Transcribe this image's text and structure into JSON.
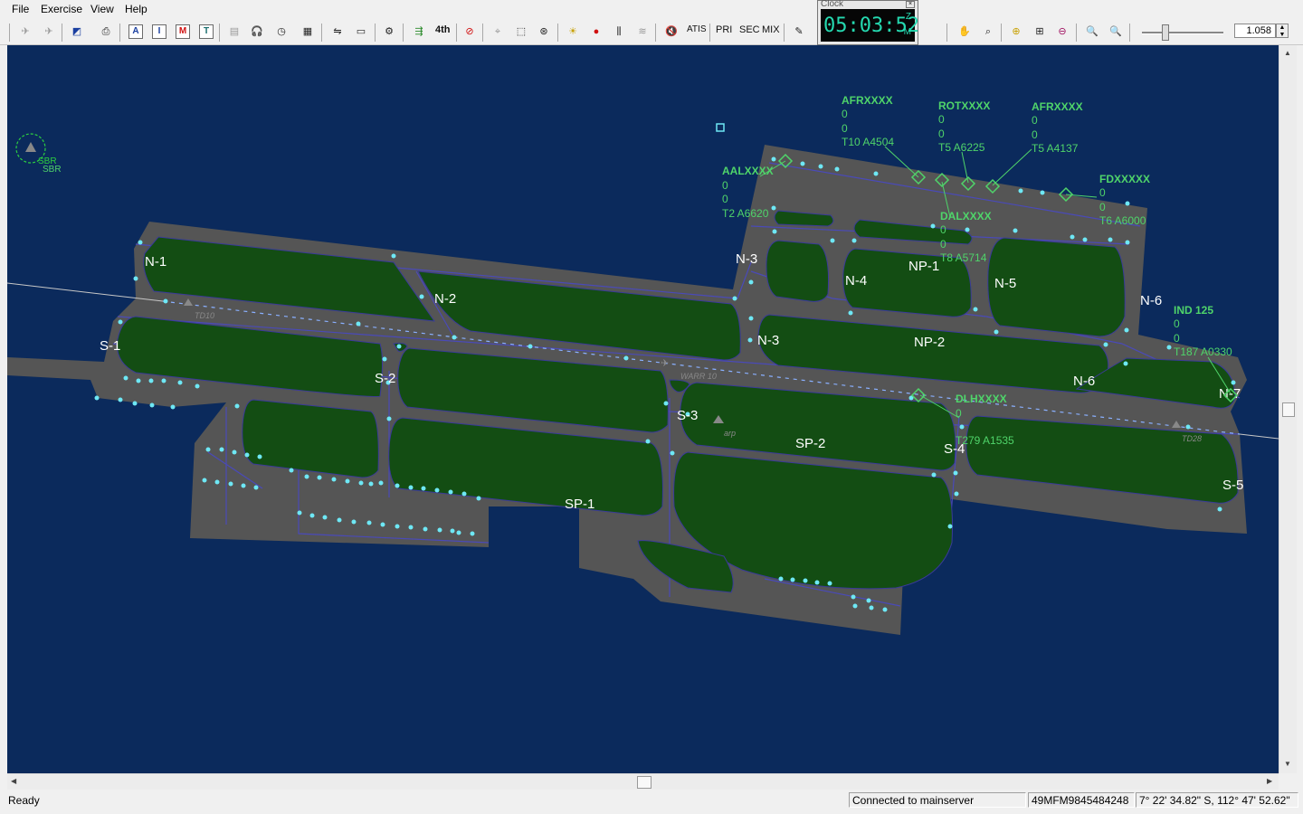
{
  "menu": [
    "File",
    "Exercise",
    "View",
    "Help"
  ],
  "toolbar": {
    "letter_buttons": [
      "A",
      "I",
      "M",
      "T"
    ],
    "level_label": "4th",
    "atis_label": "ATIS",
    "pri_label": "PRI",
    "sec_label": "SEC",
    "mix_label": "MIX",
    "zoom_value": "1.058"
  },
  "clock": {
    "title": "Clock",
    "time": "05:03:52",
    "z": "Z",
    "m": "M"
  },
  "colors": {
    "background": "#0b2a5c",
    "apron": "#555555",
    "grass": "#134d13",
    "taxiway_line": "#4a4ab8",
    "light": "#6ee8f5",
    "label_green": "#4fd46a",
    "label_white": "#ffffff"
  },
  "map": {
    "taxiway_labels": [
      "N-1",
      "N-2",
      "N-3",
      "N-3",
      "N-4",
      "NP-1",
      "N-5",
      "N-6",
      "N-6",
      "N-7",
      "NP-2",
      "S-1",
      "S-2",
      "S-3",
      "SP-1",
      "SP-2",
      "S-4",
      "S-5"
    ],
    "runway_labels": {
      "threshold_left": "TD10",
      "threshold_right": "TD28",
      "warr": "WARR 10",
      "arp": "arp"
    },
    "sbr_labels": [
      "SBR",
      "SBR"
    ],
    "aircraft": [
      {
        "callsign": "AFRXXXX",
        "line1": "0",
        "line2": "0",
        "line3": "T10 A4504"
      },
      {
        "callsign": "ROTXXXX",
        "line1": "0",
        "line2": "0",
        "line3": "T5 A6225"
      },
      {
        "callsign": "AFRXXXX",
        "line1": "0",
        "line2": "0",
        "line3": "T5 A4137"
      },
      {
        "callsign": "AALXXXX",
        "line1": "0",
        "line2": "0",
        "line3": "T2 A6620"
      },
      {
        "callsign": "FDXXXXX",
        "line1": "0",
        "line2": "0",
        "line3": "T6 A6000"
      },
      {
        "callsign": "DALXXXX",
        "line1": "0",
        "line2": "0",
        "line3": "T8 A5714"
      },
      {
        "callsign": "IND 125",
        "line1": "0",
        "line2": "0",
        "line3": "T187 A0330"
      },
      {
        "callsign": "DLHXXXX",
        "line1": "0",
        "line2": "",
        "line3": "T279 A1535"
      }
    ]
  },
  "status": {
    "ready": "Ready",
    "connection": "Connected to mainserver",
    "id": "49MFM9845484248",
    "coords": "7° 22' 34.82\" S, 112° 47' 52.62\""
  }
}
